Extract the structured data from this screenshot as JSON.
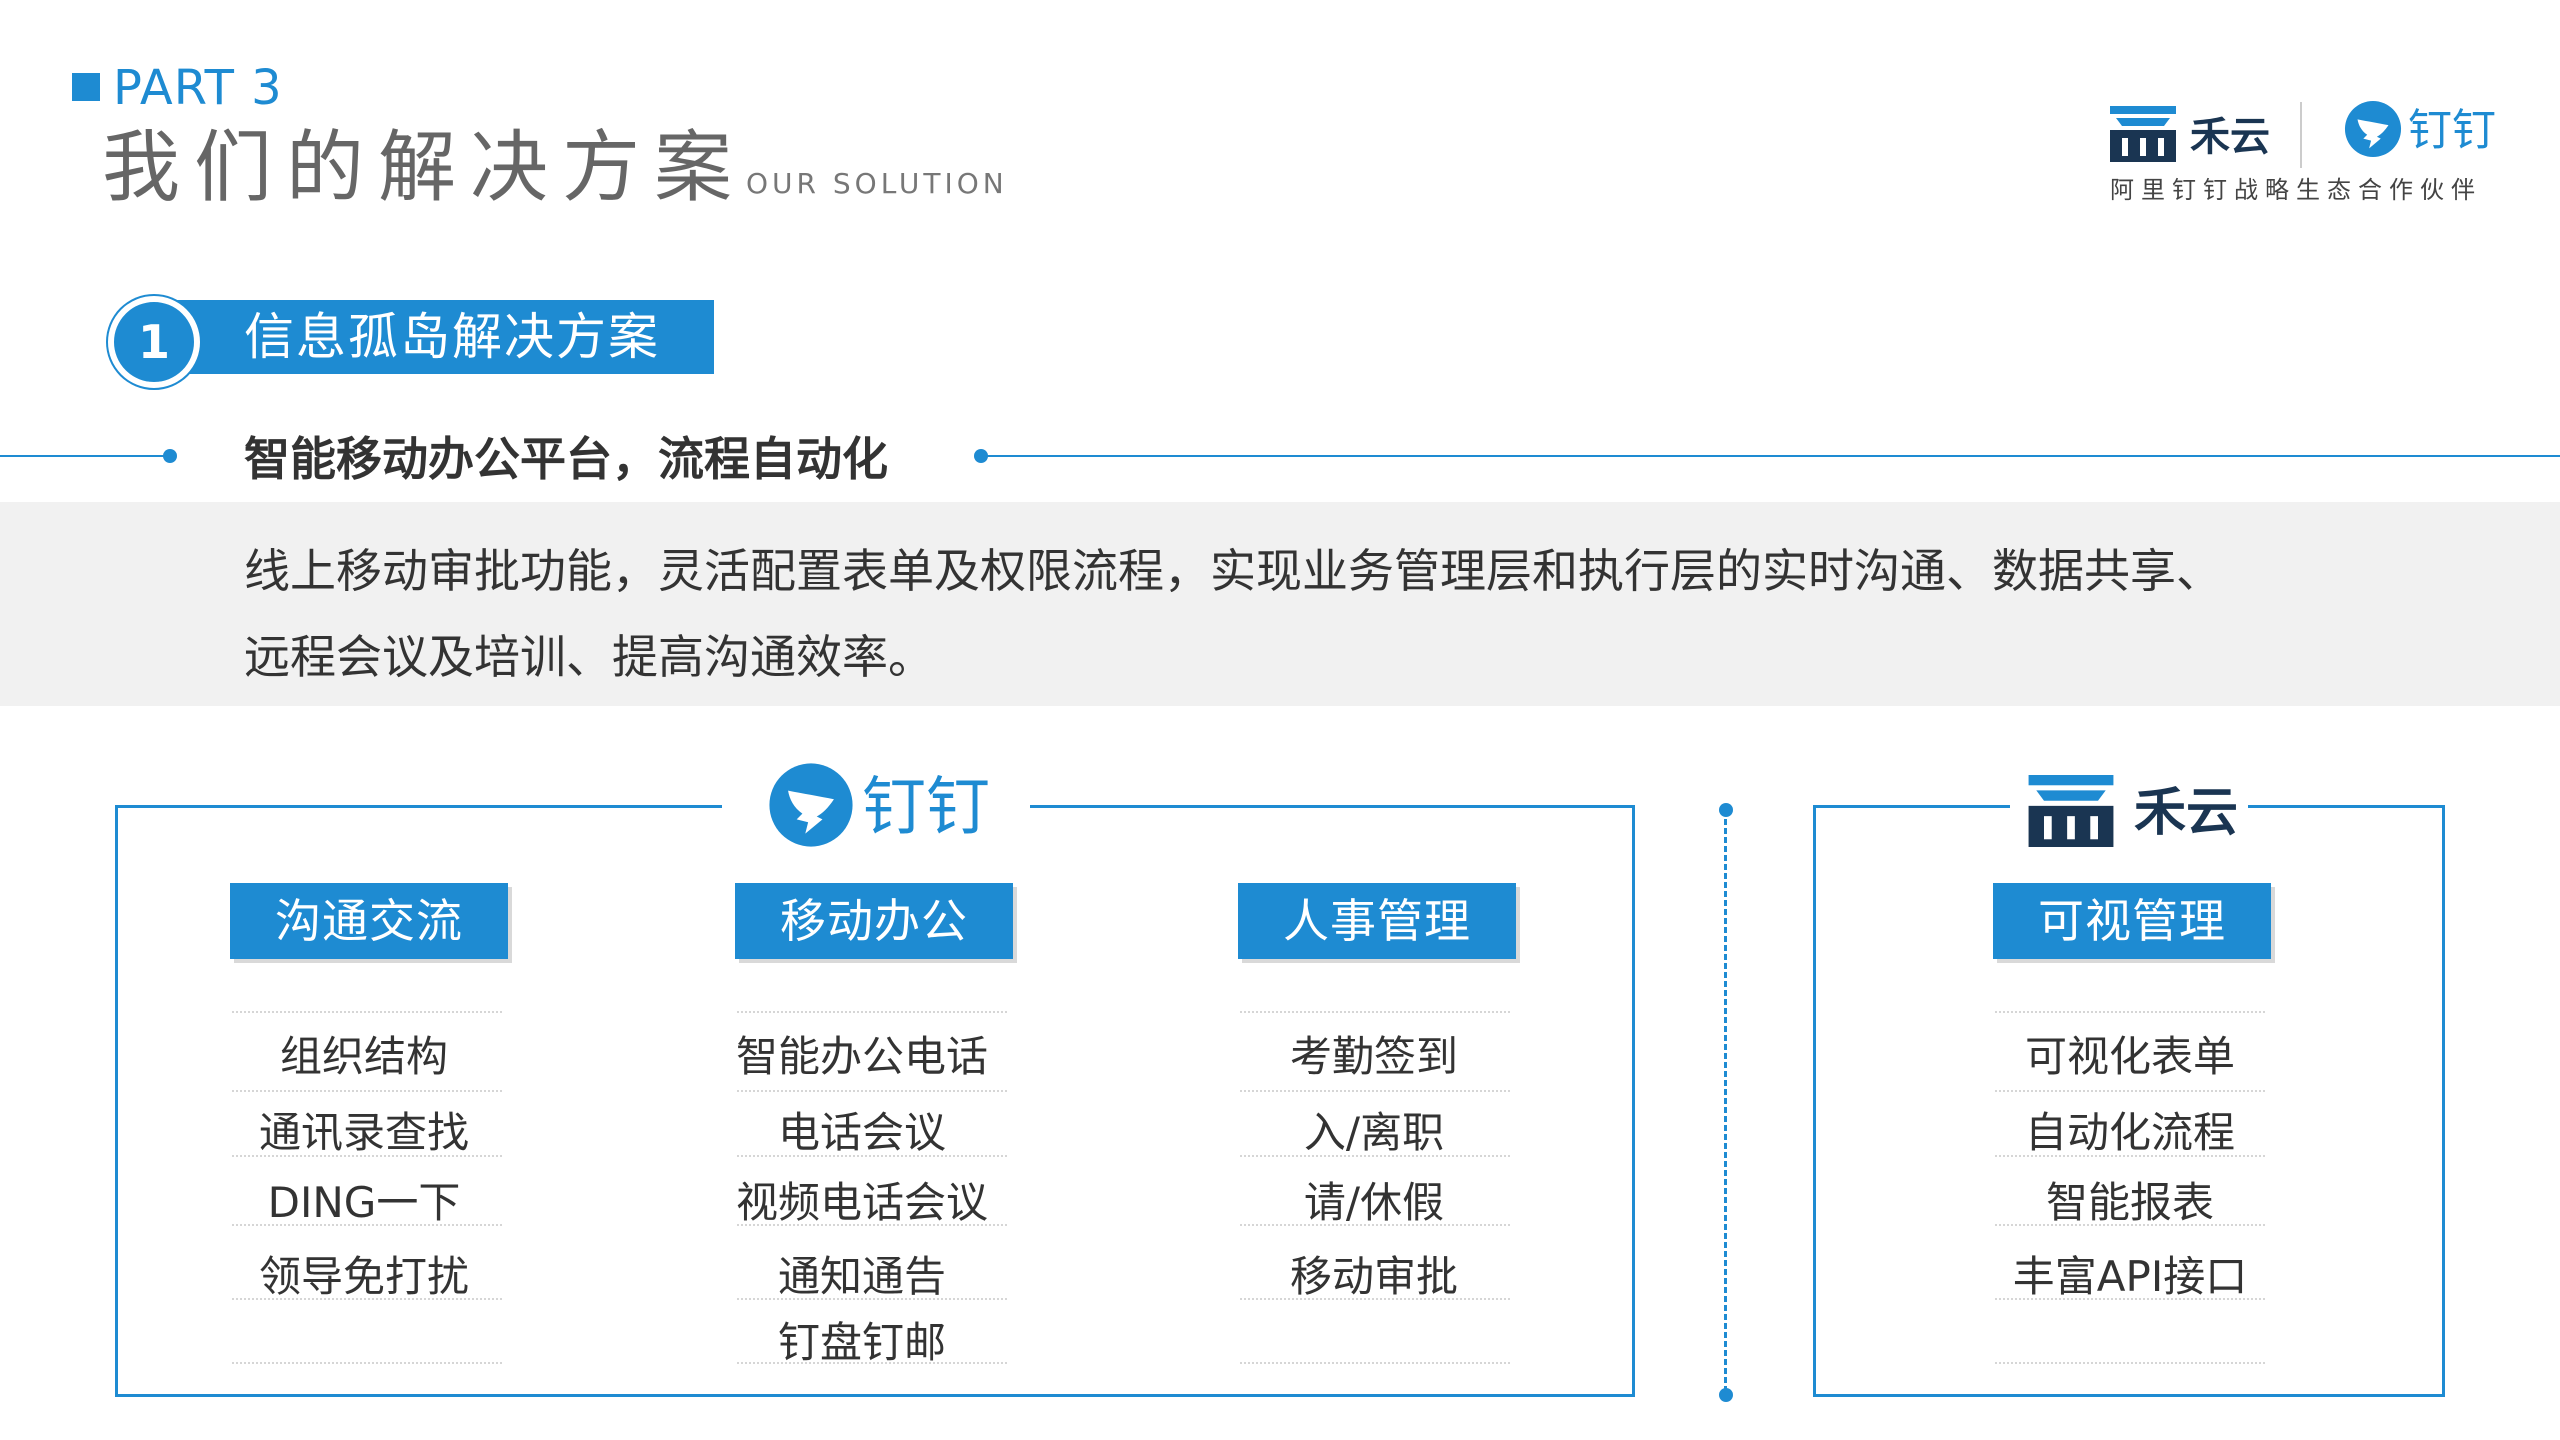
{
  "header": {
    "part_label": "PART 3",
    "title": "我们的解决方案",
    "subtitle": "OUR SOLUTION"
  },
  "brand": {
    "xiyun_name": "禾云",
    "dingtalk_name": "钉钉",
    "partner_tagline": "阿里钉钉战略生态合作伙伴"
  },
  "section": {
    "number": "1",
    "title": "信息孤岛解决方案",
    "heading": "智能移动办公平台，流程自动化",
    "description_line1": "线上移动审批功能，灵活配置表单及权限流程，实现业务管理层和执行层的实时沟通、数据共享、",
    "description_line2": "远程会议及培训、提高沟通效率。"
  },
  "dingtalk_panel": {
    "logo_text": "钉钉",
    "categories": [
      {
        "label": "沟通交流",
        "items": [
          "组织结构",
          "通讯录查找",
          "DING一下",
          "领导免打扰"
        ]
      },
      {
        "label": "移动办公",
        "items": [
          "智能办公电话",
          "电话会议",
          "视频电话会议",
          "通知通告",
          "钉盘钉邮"
        ]
      },
      {
        "label": "人事管理",
        "items": [
          "考勤签到",
          "入/离职",
          "请/休假",
          "移动审批"
        ]
      }
    ]
  },
  "xiyun_panel": {
    "logo_text": "禾云",
    "categories": [
      {
        "label": "可视管理",
        "items": [
          "可视化表单",
          "自动化流程",
          "智能报表",
          "丰富API接口"
        ]
      }
    ]
  },
  "colors": {
    "accent": "#1e8bd2",
    "dark_navy": "#1a3552",
    "band_grey": "#f1f1f1"
  },
  "icons": {
    "dingtalk": "dingtalk-wing-icon",
    "xiyun": "xiyun-building-icon"
  }
}
